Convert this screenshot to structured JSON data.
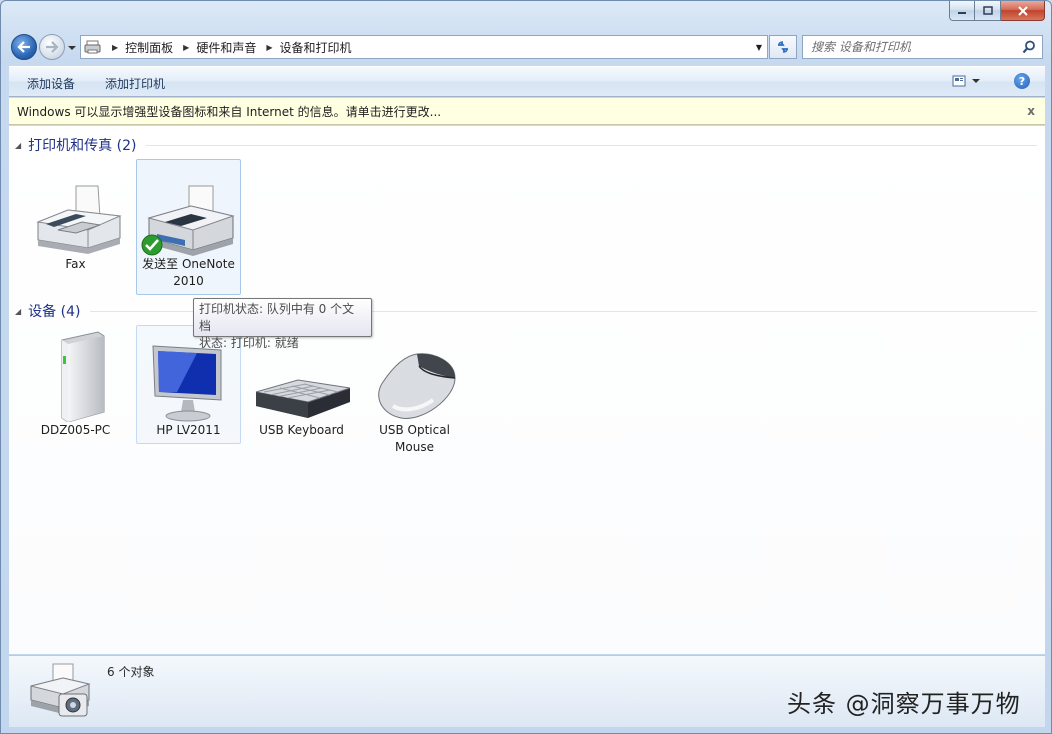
{
  "window": {
    "caption_buttons": [
      "minimize",
      "maximize",
      "close"
    ]
  },
  "address": {
    "breadcrumbs": [
      "控制面板",
      "硬件和声音",
      "设备和打印机"
    ]
  },
  "search": {
    "placeholder": "搜索 设备和打印机"
  },
  "commands": {
    "add_device": "添加设备",
    "add_printer": "添加打印机"
  },
  "infobar": {
    "text": "Windows 可以显示增强型设备图标和来自 Internet 的信息。请单击进行更改...",
    "close": "x"
  },
  "groups": [
    {
      "title": "打印机和传真 (2)",
      "items": [
        {
          "label": "Fax",
          "icon": "fax-icon"
        },
        {
          "label": "发送至 OneNote 2010",
          "icon": "printer-icon",
          "default": true
        }
      ]
    },
    {
      "title": "设备 (4)",
      "items": [
        {
          "label": "DDZ005-PC",
          "icon": "computer-tower-icon"
        },
        {
          "label": "HP LV2011",
          "icon": "monitor-icon"
        },
        {
          "label": "USB Keyboard",
          "icon": "keyboard-icon"
        },
        {
          "label": "USB Optical Mouse",
          "icon": "mouse-icon"
        }
      ]
    }
  ],
  "tooltip": {
    "line1": "打印机状态: 队列中有 0 个文档",
    "line2": "状态: 打印机: 就绪"
  },
  "details": {
    "count": "6 个对象"
  },
  "watermark": "头条 @洞察万事万物"
}
